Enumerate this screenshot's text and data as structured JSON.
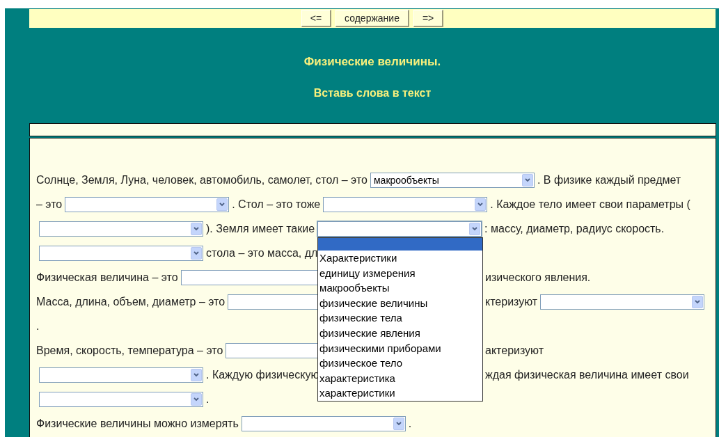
{
  "nav": [
    {
      "label": "<="
    },
    {
      "label": "содержание"
    },
    {
      "label": "=>"
    }
  ],
  "title": "Физические величины.",
  "subtitle": "Вставь слова в текст",
  "lines": [
    {
      "left": [
        {
          "kind": "text",
          "text": "Солнце, Земля, Луна, человек, автомобиль, самолет, стол – это"
        },
        {
          "kind": "select",
          "value": "макрообъекты"
        },
        {
          "kind": "text",
          "text": ". В физике каждый предмет"
        }
      ]
    },
    {
      "left": [
        {
          "kind": "text",
          "text": "– это"
        },
        {
          "kind": "select"
        },
        {
          "kind": "text",
          "text": ". Стол – это тоже"
        },
        {
          "kind": "select"
        },
        {
          "kind": "text",
          "text": ". Каждое тело имеет свои параметры ("
        }
      ]
    },
    {
      "left": [
        {
          "kind": "select"
        },
        {
          "kind": "text",
          "text": "). Земля имеет такие"
        },
        {
          "kind": "select",
          "open": true,
          "highlight_empty_option": true,
          "options": [
            "Характеристики",
            "единицу измерения",
            "макрообъекты",
            "физические величины",
            "физические тела",
            "физические явления",
            "физическими приборами",
            "физическое тело",
            "характеристика",
            "характеристики"
          ]
        },
        {
          "kind": "text",
          "text": ": массу, диаметр, радиус скорость."
        }
      ]
    },
    {
      "left": [
        {
          "kind": "select"
        },
        {
          "kind": "text",
          "text": "стола – это масса, дл"
        }
      ]
    },
    {
      "left": [
        {
          "kind": "text",
          "text": "Физическая величина – это"
        },
        {
          "kind": "select"
        }
      ],
      "right": [
        {
          "kind": "text",
          "text": "изического явления."
        }
      ]
    },
    {
      "left": [
        {
          "kind": "text",
          "text": "Масса, длина, объем, диаметр – это"
        },
        {
          "kind": "select"
        }
      ],
      "right": [
        {
          "kind": "text",
          "text": "ктеризуют"
        },
        {
          "kind": "select"
        }
      ]
    },
    {
      "left": [
        {
          "kind": "text",
          "text": "."
        }
      ]
    },
    {
      "left": [
        {
          "kind": "text",
          "text": "Время, скорость, температура – это"
        },
        {
          "kind": "select"
        }
      ],
      "right": [
        {
          "kind": "text",
          "text": "актеризуют"
        }
      ]
    },
    {
      "left": [
        {
          "kind": "select"
        },
        {
          "kind": "text",
          "text": ". Каждую физическую"
        }
      ],
      "right": [
        {
          "kind": "text",
          "text": "ждая физическая величина имеет свои"
        }
      ]
    },
    {
      "left": [
        {
          "kind": "select"
        },
        {
          "kind": "text",
          "text": "."
        }
      ]
    },
    {
      "left": [
        {
          "kind": "text",
          "text": "Физические величины можно измерять"
        },
        {
          "kind": "select"
        },
        {
          "kind": "text",
          "text": "."
        }
      ]
    }
  ]
}
